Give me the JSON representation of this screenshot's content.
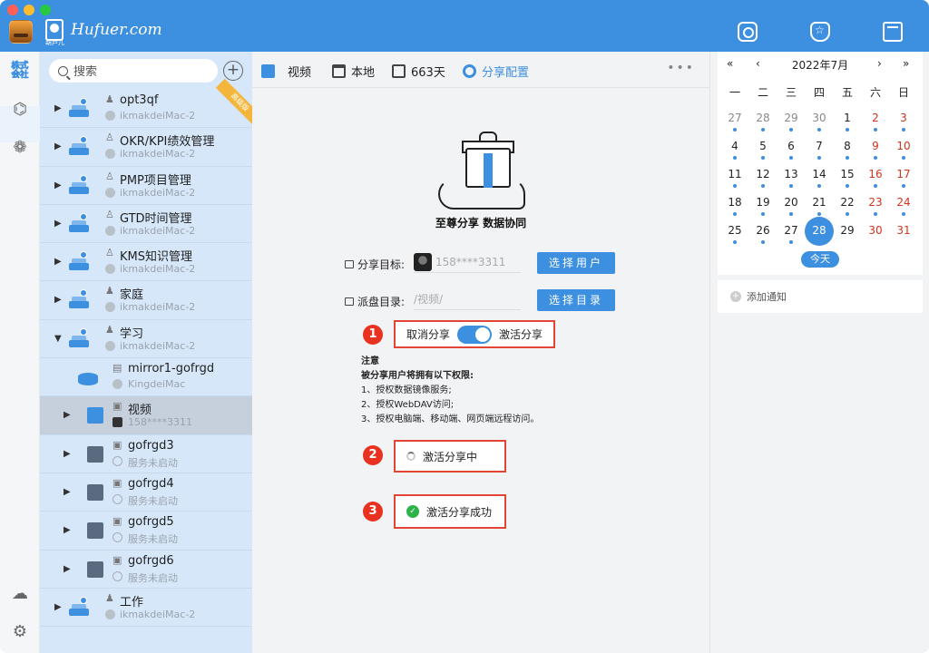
{
  "app": {
    "logo_text": "Hufuer.com",
    "logo_sub": "葫芦儿"
  },
  "colors": {
    "accent": "#3d8fdf",
    "red": "#e34535",
    "sidebar_bg": "#d6e7f9"
  },
  "iconbar": {
    "items": [
      "app-logo-icon",
      "shield-user-icon",
      "modules-icon",
      "cloud-upload-icon",
      "settings-icon"
    ]
  },
  "sidebar": {
    "search_placeholder": "搜索",
    "add_icon": "plus-circle-icon",
    "ribbon": "高级版",
    "items": [
      {
        "name": "opt3qf",
        "sub": "ikmakdeiMac-2"
      },
      {
        "name": "OKR/KPI绩效管理",
        "sub": "ikmakdeiMac-2"
      },
      {
        "name": "PMP项目管理",
        "sub": "ikmakdeiMac-2"
      },
      {
        "name": "GTD时间管理",
        "sub": "ikmakdeiMac-2"
      },
      {
        "name": "KMS知识管理",
        "sub": "ikmakdeiMac-2"
      },
      {
        "name": "家庭",
        "sub": "ikmakdeiMac-2"
      },
      {
        "name": "学习",
        "sub": "ikmakdeiMac-2"
      },
      {
        "name": "mirror1-gofrgd",
        "sub": "KingdeiMac"
      },
      {
        "name": "视频",
        "sub": "158****3311"
      },
      {
        "name": "gofrgd3",
        "sub": "服务未启动"
      },
      {
        "name": "gofrgd4",
        "sub": "服务未启动"
      },
      {
        "name": "gofrgd5",
        "sub": "服务未启动"
      },
      {
        "name": "gofrgd6",
        "sub": "服务未启动"
      },
      {
        "name": "工作",
        "sub": "ikmakdeiMac-2"
      }
    ]
  },
  "toolbar": {
    "folder": "视频",
    "location": "本地",
    "days": "663天",
    "share_config": "分享配置",
    "more": "•••"
  },
  "share": {
    "slogan": "至尊分享 数据协同",
    "target_label": "分享目标:",
    "target_value": "158****3311",
    "select_user_button": "选择用户",
    "dir_label": "派盘目录:",
    "dir_value": "/视频/",
    "select_dir_button": "选择目录",
    "step1": "1",
    "cancel_share": "取消分享",
    "activate_share": "激活分享",
    "toggle_state": "on",
    "notes_title": "注意",
    "notes_subtitle": "被分享用户将拥有以下权限:",
    "notes": [
      "1、授权数据镜像服务;",
      "2、授权WebDAV访问;",
      "3、授权电脑端、移动端、网页端远程访问。"
    ],
    "step2": "2",
    "activating": "激活分享中",
    "step3": "3",
    "success": "激活分享成功"
  },
  "calendar": {
    "prev_year": "«",
    "prev_month": "‹",
    "title": "2022年7月",
    "next_month": "›",
    "next_year": "»",
    "weekdays": [
      "一",
      "二",
      "三",
      "四",
      "五",
      "六",
      "日"
    ],
    "weeks": [
      [
        "27",
        "28",
        "29",
        "30",
        "1",
        "2",
        "3"
      ],
      [
        "4",
        "5",
        "6",
        "7",
        "8",
        "9",
        "10"
      ],
      [
        "11",
        "12",
        "13",
        "14",
        "15",
        "16",
        "17"
      ],
      [
        "18",
        "19",
        "20",
        "21",
        "22",
        "23",
        "24"
      ],
      [
        "25",
        "26",
        "27",
        "28",
        "29",
        "30",
        "31"
      ]
    ],
    "today_button": "今天",
    "add_notice": "添加通知"
  }
}
